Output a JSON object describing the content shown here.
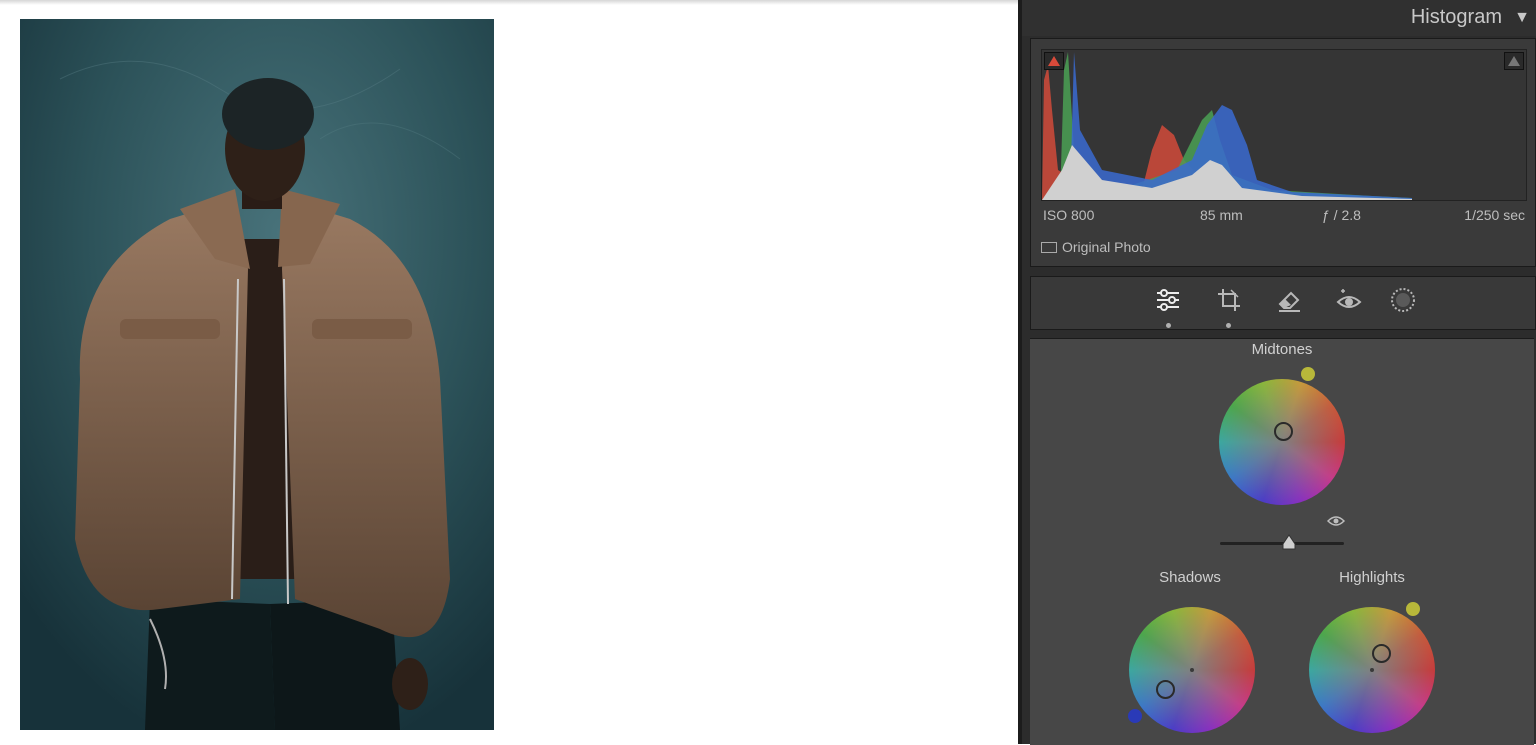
{
  "histogram": {
    "title": "Histogram",
    "collapse_icon": "triangle-down-icon",
    "shadow_clip_color": "#d84a3a",
    "exif": {
      "iso": "ISO 800",
      "focal_length": "85 mm",
      "aperture": "ƒ / 2.8",
      "shutter": "1/250 sec"
    },
    "original_photo_label": "Original Photo"
  },
  "tools": [
    {
      "name": "edit-sliders-icon",
      "active": true,
      "dot": true
    },
    {
      "name": "crop-icon",
      "active": false,
      "dot": true
    },
    {
      "name": "eraser-icon",
      "active": false,
      "dot": false
    },
    {
      "name": "red-eye-icon",
      "active": false,
      "dot": false
    },
    {
      "name": "masking-icon",
      "active": false,
      "dot": false
    }
  ],
  "color_grading": {
    "midtones_label": "Midtones",
    "shadows_label": "Shadows",
    "highlights_label": "Highlights",
    "midtones_hue_color": "#b8b83a",
    "shadows_hue_color": "#2a3ab8",
    "highlights_hue_color": "#b8b83a"
  }
}
